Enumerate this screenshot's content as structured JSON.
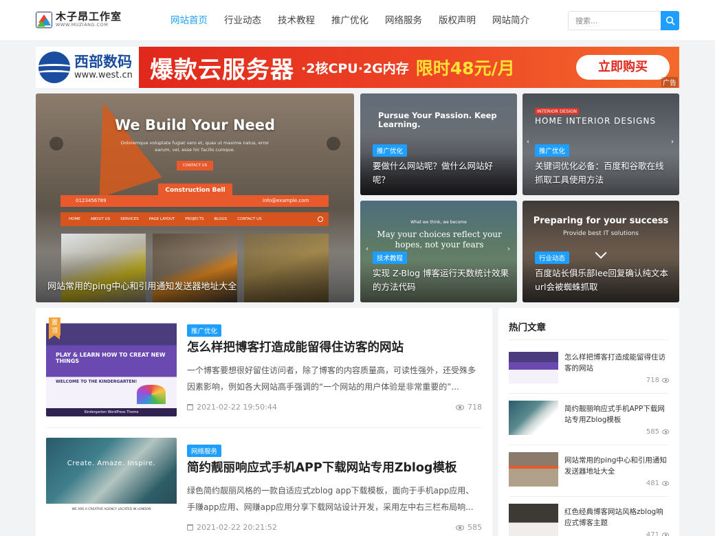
{
  "site": {
    "logo_cn": "木子昂工作室",
    "logo_en": "WWW.MUZIANG.COM",
    "colors": {
      "accent": "#1e9fff",
      "ribbon": "#f2a33a",
      "ad_red": "#e0281c"
    }
  },
  "nav": {
    "items": [
      {
        "label": "网站首页",
        "active": true
      },
      {
        "label": "行业动态",
        "active": false
      },
      {
        "label": "技术教程",
        "active": false
      },
      {
        "label": "推广优化",
        "active": false
      },
      {
        "label": "网络服务",
        "active": false
      },
      {
        "label": "版权声明",
        "active": false
      },
      {
        "label": "网站简介",
        "active": false
      }
    ]
  },
  "search": {
    "placeholder": "搜索...",
    "icon": "search-icon"
  },
  "banner": {
    "brand_cn": "西部数码",
    "brand_en": "www.west.cn",
    "main": "爆款云服务器",
    "sub": "·2核CPU·2G内存",
    "price": "限时48元/月",
    "button": "立即购买",
    "ad_label": "广告"
  },
  "slider": {
    "image_title": "We Build Your Need",
    "image_desc": "Doloremque voluptate fugiat vero et, quas ut maxime natus, error earum, vel, esse hic facilis cumque.",
    "image_button": "CONTACT US",
    "image_brand": "Construction Bell",
    "image_phone": "0123456789",
    "image_email": "info@example.com",
    "image_menu": [
      "HOME",
      "ABOUT US",
      "SERVICES",
      "PAGE LAYOUT",
      "PROJECTS",
      "BLOGS",
      "CONTACT US"
    ],
    "caption": "网站常用的ping中心和引用通知发送器地址大全"
  },
  "cards": [
    {
      "image_text": "Pursue Your Passion. Keep Learning.",
      "tag": "推广优化",
      "title": "要做什么网站呢？做什么网站好呢？"
    },
    {
      "image_text": "HOME INTERIOR DESIGNS",
      "image_label": "INTERIOR DESIGN",
      "tag": "推广优化",
      "title": "关键词优化必备：百度和谷歌在线抓取工具使用方法"
    },
    {
      "image_text": "May your choices reflect your hopes, not your fears",
      "image_label": "What we think, we become",
      "tag": "技术教程",
      "title": "实现 Z-Blog 博客运行天数统计效果的方法代码"
    },
    {
      "image_text": "Preparing for your success",
      "image_sub": "Provide best IT solutions",
      "tag": "行业动态",
      "title": "百度站长俱乐部lee回复确认纯文本url会被蜘蛛抓取"
    }
  ],
  "articles": [
    {
      "ribbon": "置顶",
      "image_text": "PLAY & LEARN HOW TO CREAT NEW THINGS",
      "image_sub": "WELCOME TO THE KINDERGARTEN!",
      "image_footer": "Kindergarten WordPress Theme",
      "tag": "推广优化",
      "title": "怎么样把博客打造成能留得住访客的网站",
      "excerpt": "一个博客要想很好留住访问者，除了博客的内容质量高，可读性强外，还受殊多因素影响，例如各大网站高手强调的“一个网站的用户体验是非常重要的”...",
      "date": "2021-02-22 19:50:44",
      "views": "718"
    },
    {
      "image_text": "Create. Amaze. Inspire.",
      "image_footer": "WE ARE A CREATIVE AGENCY LOCATED IN LONDON",
      "tag": "网络服务",
      "title": "简约靓丽响应式手机APP下载网站专用Zblog模板",
      "excerpt": "绿色简约靓丽风格的一款自适应式zblog app下载模板，面向于手机app应用、手赚app应用、网赚app应用分享下载网站设计开发，采用左中右三栏布局响...",
      "date": "2021-02-22 20:21:52",
      "views": "585"
    }
  ],
  "sidebar": {
    "title": "热门文章",
    "items": [
      {
        "title": "怎么样把博客打造成能留得住访客的网站",
        "views": "718"
      },
      {
        "title": "简约靓丽响应式手机APP下载网站专用Zblog模板",
        "views": "585"
      },
      {
        "title": "网站常用的ping中心和引用通知发送器地址大全",
        "views": "481"
      },
      {
        "title": "红色经典博客网站风格zblog响应式博客主题",
        "views": "471"
      }
    ]
  }
}
